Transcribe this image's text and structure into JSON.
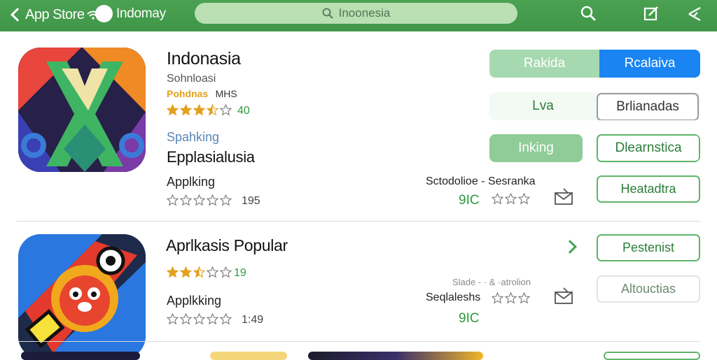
{
  "topbar": {
    "back_label": "App Store",
    "store_name": "Indomay",
    "search_value": "Inoonesia"
  },
  "app1": {
    "title": "Indonasia",
    "developer": "Sohnloasi",
    "category": "Pohdnas",
    "size": "MHS",
    "rating": 3.5,
    "rating_count": "40",
    "section_label": "Spahking",
    "section_title": "Epplasialusia",
    "sub_label": "Applking",
    "sub_rating_count": "195",
    "meta_line": "Sctodolioe - Sesranka",
    "price": "9IC",
    "seg1": {
      "left": "Rakida",
      "right": "Rcalaiva"
    },
    "seg2": {
      "left": "Lva",
      "right": "Brlianadas"
    },
    "seg3": {
      "left": "Inking",
      "right": "Dlearnstica"
    },
    "action_button": "Heatadtra"
  },
  "app2": {
    "title": "Aprlkasis Popular",
    "rating": 2.5,
    "rating_count": "19",
    "sub_label": "Applkking",
    "sub_rating_count": "1:49",
    "meta_top": "Slade - · & ·atrolion",
    "meta_label": "Seqlaleshs",
    "price": "9IC",
    "button1": "Pestenist",
    "button2": "Altouctias"
  },
  "colors": {
    "brand_green": "#4aa152",
    "accent_blue": "#1a84f2",
    "star_gold": "#e3a11c"
  }
}
